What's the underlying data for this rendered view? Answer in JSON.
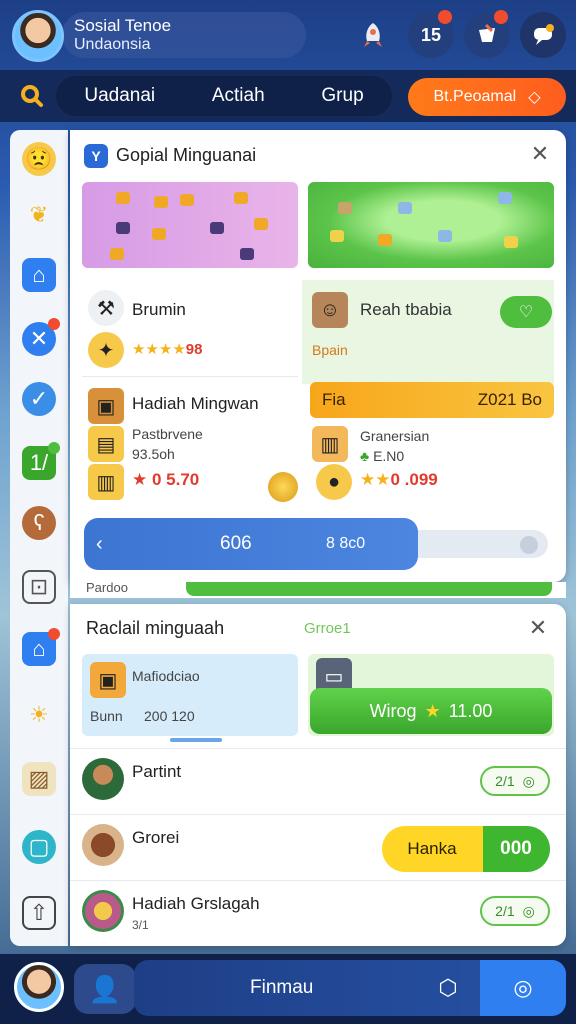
{
  "header": {
    "profile_name": "Sosial Tenoe",
    "profile_sub": "Undaonsia",
    "icons": [
      "rocket-icon",
      "notification-icon",
      "trophy-icon",
      "chat-icon"
    ],
    "badge_count": "15"
  },
  "nav": {
    "tabs": [
      "Uadanai",
      "Actiah",
      "Grup"
    ],
    "cta_label": "Bt.Peoamal"
  },
  "card1": {
    "title": "Gopial Minguanai",
    "left_item": {
      "label": "Brumin",
      "stars_value": "98"
    },
    "right_item": {
      "label": "Reah tbabia",
      "sub": "Bpain"
    },
    "orange_bar": {
      "left": "Fia",
      "right": "Z021 Bo"
    },
    "reward_left": {
      "label": "Hadiah Mingwan",
      "sub1": "Pastbrvene",
      "sub2": "93.5oh",
      "value": "0 5.70"
    },
    "reward_right": {
      "label": "Granersian",
      "sub": "E.N0",
      "value": "0 .099"
    },
    "progress": {
      "label": "606",
      "detail": "8 8c0",
      "fraction": 0.72
    }
  },
  "strip_label": "Pardoo",
  "card2": {
    "title": "Raclail minguaah",
    "subtitle": "Grroe1",
    "blue_box": {
      "label": "Mafiodciao",
      "sub": "Bunn",
      "value": "200 120"
    },
    "green_button": {
      "label": "Wirog",
      "value": "11.00"
    },
    "rows": [
      {
        "label": "Partint",
        "sub": "",
        "pill": "2/1"
      },
      {
        "label": "Grorei",
        "sub": "",
        "action_label": "Hanka",
        "action_value": "000"
      },
      {
        "label": "Hadiah Grslagah",
        "sub": "3/1",
        "pill": "2/1"
      }
    ]
  },
  "bottom": {
    "label": "Finmau"
  }
}
